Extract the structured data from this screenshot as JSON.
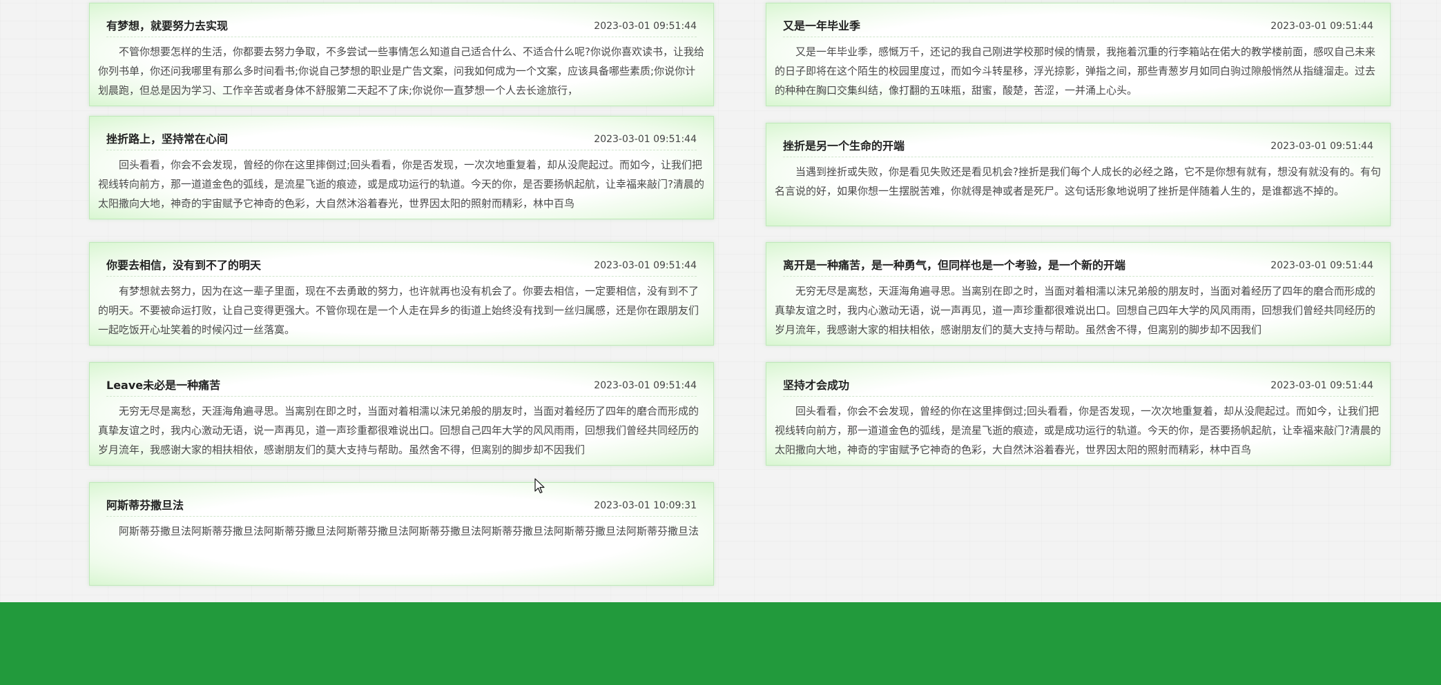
{
  "articles": [
    {
      "title": "有梦想，就要努力去实现",
      "date": "2023-03-01 09:51:44",
      "excerpt": "不管你想要怎样的生活，你都要去努力争取，不多尝试一些事情怎么知道自己适合什么、不适合什么呢?你说你喜欢读书，让我给你列书单，你还问我哪里有那么多时间看书;你说自己梦想的职业是广告文案，问我如何成为一个文案，应该具备哪些素质;你说你计划晨跑，但总是因为学习、工作辛苦或者身体不舒服第二天起不了床;你说你一直梦想一个人去长途旅行，"
    },
    {
      "title": "又是一年毕业季",
      "date": "2023-03-01 09:51:44",
      "excerpt": "又是一年毕业季，感慨万千，还记的我自己刚进学校那时候的情景，我拖着沉重的行李箱站在偌大的教学楼前面，感叹自己未来的日子即将在这个陌生的校园里度过，而如今斗转星移，浮光掠影，弹指之间，那些青葱岁月如同白驹过隙般悄然从指缝溜走。过去的种种在胸口交集纠结，像打翻的五味瓶，甜蜜，酸楚，苦涩，一并涌上心头。"
    },
    {
      "title": "挫折路上，坚持常在心间",
      "date": "2023-03-01 09:51:44",
      "excerpt": "回头看看，你会不会发现，曾经的你在这里摔倒过;回头看看，你是否发现，一次次地重复着，却从没爬起过。而如今，让我们把视线转向前方，那一道道金色的弧线，是流星飞逝的痕迹，或是成功运行的轨道。今天的你，是否要扬帆起航，让幸福来敲门?清晨的太阳撒向大地，神奇的宇宙赋予它神奇的色彩，大自然沐浴着春光，世界因太阳的照射而精彩，林中百鸟"
    },
    {
      "title": "挫折是另一个生命的开端",
      "date": "2023-03-01 09:51:44",
      "excerpt": "当遇到挫折或失败，你是看见失败还是看见机会?挫折是我们每个人成长的必经之路，它不是你想有就有，想没有就没有的。有句名言说的好，如果你想一生摆脱苦难，你就得是神或者是死尸。这句话形象地说明了挫折是伴随着人生的，是谁都逃不掉的。"
    },
    {
      "title": "你要去相信，没有到不了的明天",
      "date": "2023-03-01 09:51:44",
      "excerpt": "有梦想就去努力，因为在这一辈子里面，现在不去勇敢的努力，也许就再也没有机会了。你要去相信，一定要相信，没有到不了的明天。不要被命运打败，让自己变得更强大。不管你现在是一个人走在异乡的街道上始终没有找到一丝归属感，还是你在跟朋友们一起吃饭开心址笑着的时候闪过一丝落寞。"
    },
    {
      "title": "离开是一种痛苦，是一种勇气，但同样也是一个考验，是一个新的开端",
      "date": "2023-03-01 09:51:44",
      "excerpt": "无穷无尽是离愁，天涯海角遍寻思。当离别在即之时，当面对着相濡以沫兄弟般的朋友时，当面对着经历了四年的磨合而形成的真挚友谊之时，我内心激动无语，说一声再见，道一声珍重都很难说出口。回想自己四年大学的风风雨雨，回想我们曾经共同经历的岁月流年，我感谢大家的相扶相依，感谢朋友们的莫大支持与帮助。虽然舍不得，但离别的脚步却不因我们"
    },
    {
      "title": "Leave未必是一种痛苦",
      "date": "2023-03-01 09:51:44",
      "excerpt": "无穷无尽是离愁，天涯海角遍寻思。当离别在即之时，当面对着相濡以沫兄弟般的朋友时，当面对着经历了四年的磨合而形成的真挚友谊之时，我内心激动无语，说一声再见，道一声珍重都很难说出口。回想自己四年大学的风风雨雨，回想我们曾经共同经历的岁月流年，我感谢大家的相扶相依，感谢朋友们的莫大支持与帮助。虽然舍不得，但离别的脚步却不因我们"
    },
    {
      "title": "坚持才会成功",
      "date": "2023-03-01 09:51:44",
      "excerpt": "回头看看，你会不会发现，曾经的你在这里摔倒过;回头看看，你是否发现，一次次地重复着，却从没爬起过。而如今，让我们把视线转向前方，那一道道金色的弧线，是流星飞逝的痕迹，或是成功运行的轨道。今天的你，是否要扬帆起航，让幸福来敲门?清晨的太阳撒向大地，神奇的宇宙赋予它神奇的色彩，大自然沐浴着春光，世界因太阳的照射而精彩，林中百鸟"
    },
    {
      "title": "阿斯蒂芬撒旦法",
      "date": "2023-03-01 10:09:31",
      "excerpt": "阿斯蒂芬撒旦法阿斯蒂芬撒旦法阿斯蒂芬撒旦法阿斯蒂芬撒旦法阿斯蒂芬撒旦法阿斯蒂芬撒旦法阿斯蒂芬撒旦法阿斯蒂芬撒旦法"
    }
  ],
  "colors": {
    "footer": "#229a3c",
    "card_border": "#bfe9b9",
    "card_glow": "#d9f6d2"
  },
  "icons": {
    "cursor": "mouse-pointer-icon"
  }
}
